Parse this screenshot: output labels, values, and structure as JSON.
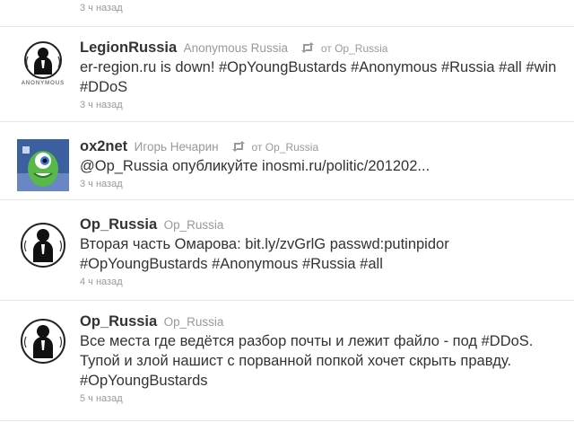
{
  "top_item": {
    "time": "3 ч назад"
  },
  "tweets": [
    {
      "name": "LegionRussia",
      "handle": "Anonymous Russia",
      "retweet_from": "от Op_Russia",
      "text": "er-region.ru is down! #OpYoungBustards #Anonymous #Russia #all #win #DDoS",
      "time": "3 ч назад",
      "avatar_caption": "ANONYMOUS"
    },
    {
      "name": "ox2net",
      "handle": "Игорь Нечарин",
      "retweet_from": "от Op_Russia",
      "text": "@Op_Russia опубликуйте inosmi.ru/politic/201202...",
      "time": "3 ч назад"
    },
    {
      "name": "Op_Russia",
      "handle": "Op_Russia",
      "text": "Вторая часть Омарова: bit.ly/zvGrlG passwd:putinpidor #OpYoungBustards #Anonymous #Russia #all",
      "time": "4 ч назад"
    },
    {
      "name": "Op_Russia",
      "handle": "Op_Russia",
      "text": "Все места где ведётся разбор почты и лежит файло - под #DDoS. Тупой и злой нашист с порванной попкой хочет скрыть правду. #OpYoungBustards",
      "time": "5 ч назад"
    }
  ],
  "colors": {
    "name": "#333333",
    "meta": "#999999",
    "divider": "#e6e6e6"
  }
}
